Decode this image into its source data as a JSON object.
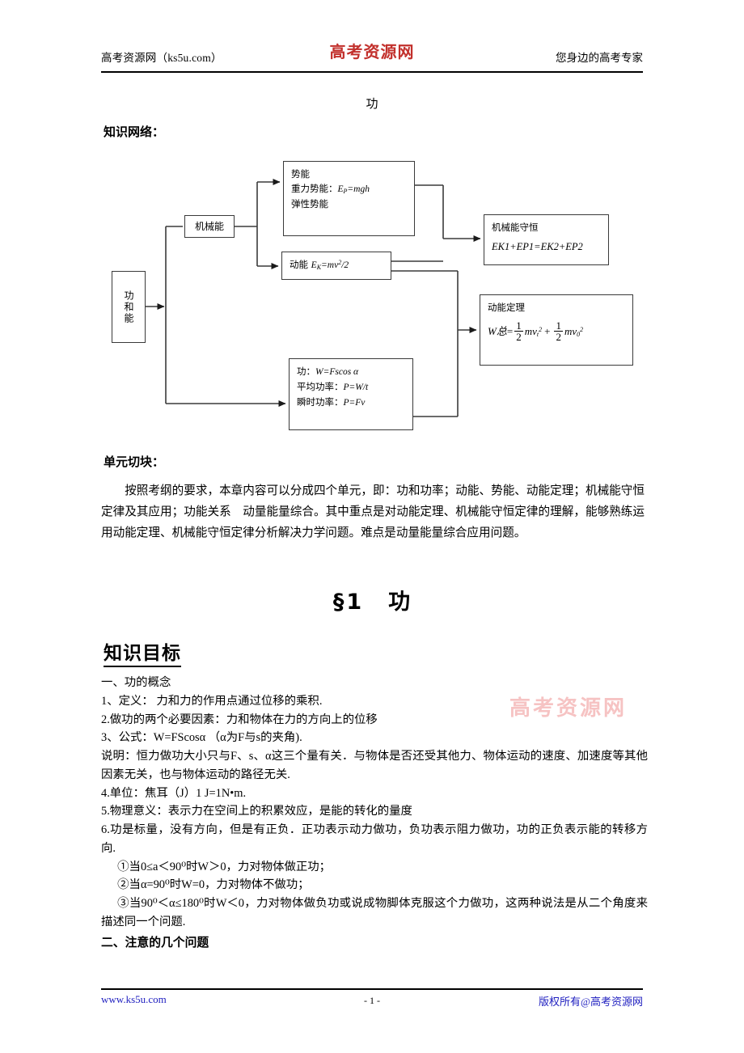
{
  "header": {
    "left": "高考资源网（ks5u.com）",
    "center": "高考资源网",
    "right": "您身边的高考专家",
    "center_color": "#c2302c"
  },
  "doc_title": "功",
  "labels": {
    "knowledge_network": "知识网络：",
    "unit_block": "单元切块："
  },
  "diagram": {
    "boxes": {
      "work_and_energy": "功和能",
      "mechanical_energy": "机械能",
      "potential_energy": {
        "line1": "势能",
        "line2_label": "重力势能：",
        "line2_formula_base": "E",
        "line2_formula_sub": "P",
        "line2_formula_rest": "=mgh",
        "line3": "弹性势能"
      },
      "kinetic_energy": {
        "label": "动能",
        "formula_base": "E",
        "formula_sub": "K",
        "formula_rest": "=mv",
        "formula_sup": "2",
        "formula_tail": "/2"
      },
      "work_power": {
        "line1_label": "功：",
        "line1_formula": "W=Fscos α",
        "line2_label": "平均功率：",
        "line2_formula": "P=W/t",
        "line3_label": "瞬时功率：",
        "line3_formula": "P=Fv"
      },
      "conservation": {
        "title": "机械能守恒",
        "formula": "EK1+EP1=EK2+EP2"
      },
      "kinetic_theorem": {
        "title": "动能定理",
        "formula_lhs": "W总",
        "formula_eq": "=",
        "frac1_num": "1",
        "frac1_den": "2",
        "term1": "mv",
        "term1_sub": "t",
        "term1_sup": "2",
        "plus": "+",
        "frac2_num": "1",
        "frac2_den": "2",
        "term2": "mv",
        "term2_sub": "0",
        "term2_sup": "2"
      }
    }
  },
  "unit_paragraph": "按照考纲的要求，本章内容可以分成四个单元，即：功和功率；动能、势能、动能定理；机械能守恒定律及其应用；功能关系　动量能量综合。其中重点是对动能定理、机械能守恒定律的理解，能够熟练运用动能定理、机械能守恒定律分析解决力学问题。难点是动量能量综合应用问题。",
  "big_title": "§1　功",
  "knowledge_goal_heading": "知识目标",
  "content_lines": [
    "一、功的概念",
    "1、定义： 力和力的作用点通过位移的乘积.",
    "2.做功的两个必要因素：力和物体在力的方向上的位移",
    "3、公式：W=FScosα （α为F与s的夹角).",
    "说明：恒力做功大小只与F、s、α这三个量有关．与物体是否还受其他力、物体运动的速度、加速度等其他因素无关，也与物体运动的路径无关.",
    "4.单位：焦耳（J）1 J=1N•m.",
    "5.物理意义：表示力在空间上的积累效应，是能的转化的量度",
    "6.功是标量，没有方向，但是有正负．正功表示动力做功，负功表示阻力做功，功的正负表示能的转移方向.",
    "①当0≤a＜90⁰时W＞0，力对物体做正功；",
    "②当α=90⁰时W=0，力对物体不做功；",
    "③当90⁰＜α≤180⁰时W＜0，力对物体做负功或说成物脚体克服这个力做功，这两种说法是从二个角度来描述同一个问题.",
    "二、注意的几个问题"
  ],
  "watermark": "高考资源网",
  "footer": {
    "left": "www.ks5u.com",
    "page": "- 1 -",
    "right": "版权所有@高考资源网",
    "link_color": "#2020c0"
  }
}
